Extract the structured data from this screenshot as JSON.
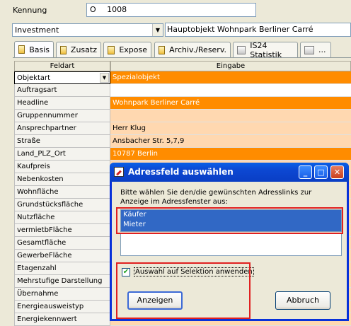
{
  "header": {
    "kennung_label": "Kennung",
    "kennung_prefix": "O",
    "kennung_value": "1008",
    "type_select": "Investment",
    "object_title": "Hauptobjekt Wohnpark Berliner Carré"
  },
  "tabs": [
    {
      "label": "Basis",
      "active": true
    },
    {
      "label": "Zusatz"
    },
    {
      "label": "Expose"
    },
    {
      "label": "Archiv./Reserv."
    },
    {
      "label": "IS24 Statistik"
    },
    {
      "label": "..."
    }
  ],
  "grid": {
    "col_field": "Feldart",
    "col_input": "Eingabe",
    "rows": [
      {
        "field": "Objektart",
        "value": "Spezialobjekt",
        "style": "orange"
      },
      {
        "field": "Auftragsart",
        "value": "",
        "style": "white"
      },
      {
        "field": "Headline",
        "value": "Wohnpark Berliner Carré",
        "style": "orange"
      },
      {
        "field": "Gruppennummer",
        "value": "",
        "style": "peach"
      },
      {
        "field": "Ansprechpartner",
        "value": "Herr Klug",
        "style": "peach"
      },
      {
        "field": "Straße",
        "value": "Ansbacher Str. 5,7,9",
        "style": "peach"
      },
      {
        "field": "Land_PLZ_Ort",
        "value": "10787 Berlin",
        "style": "orange"
      },
      {
        "field": "Kaufpreis",
        "value": "",
        "style": "peach"
      },
      {
        "field": "Nebenkosten",
        "value": "",
        "style": "peach"
      },
      {
        "field": "Wohnfläche",
        "value": "",
        "style": "peach"
      },
      {
        "field": "Grundstücksfläche",
        "value": "",
        "style": "peach"
      },
      {
        "field": "Nutzfläche",
        "value": "",
        "style": "peach"
      },
      {
        "field": "vermietbFläche",
        "value": "",
        "style": "peach"
      },
      {
        "field": "Gesamtfläche",
        "value": "",
        "style": "peach"
      },
      {
        "field": "GewerbeFläche",
        "value": "",
        "style": "peach"
      },
      {
        "field": "Etagenzahl",
        "value": "",
        "style": "peach"
      },
      {
        "field": "Mehrstufige Darstellung",
        "value": "",
        "style": "peach"
      },
      {
        "field": "Übernahme",
        "value": "",
        "style": "peach"
      },
      {
        "field": "Energieausweistyp",
        "value": "",
        "style": "peach"
      },
      {
        "field": "Energiekennwert",
        "value": "",
        "style": "peach"
      }
    ]
  },
  "dialog": {
    "title": "Adressfeld auswählen",
    "prompt": "Bitte wählen Sie den/die gewünschten Adresslinks zur Anzeige im Adressfenster aus:",
    "options": [
      "Käufer",
      "Mieter"
    ],
    "checkbox_label": "Auswahl auf Selektion anwenden",
    "checkbox_checked": true,
    "ok_label": "Anzeigen",
    "cancel_label": "Abbruch",
    "minimize": "_",
    "maximize": "□",
    "close": "✕"
  },
  "icons": {
    "dropdown": "▼",
    "check": "✔"
  }
}
